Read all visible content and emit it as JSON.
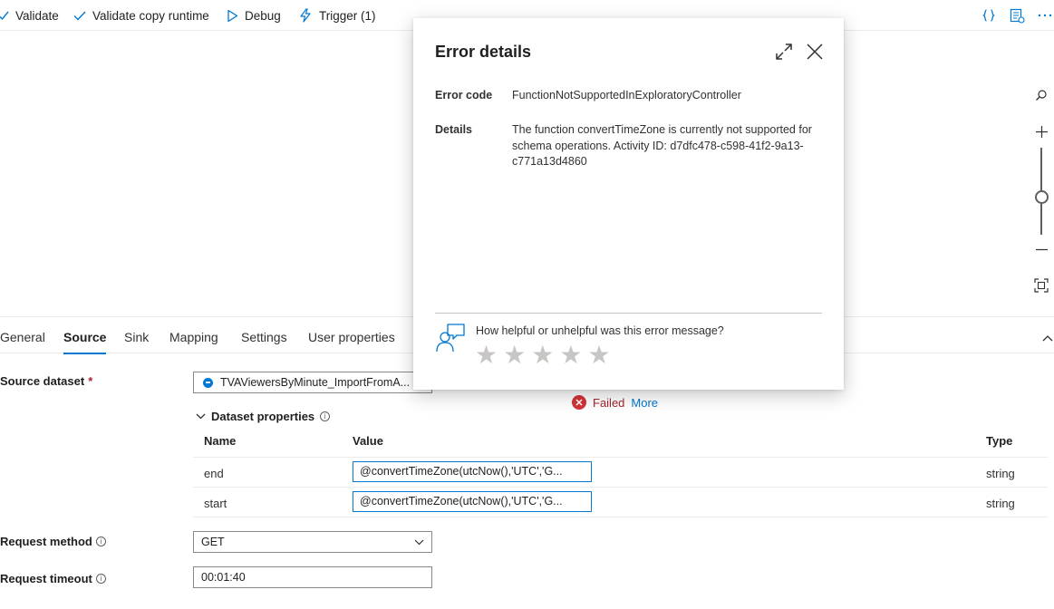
{
  "toolbar": {
    "validate": "Validate",
    "validate_copy_runtime": "Validate copy runtime",
    "debug": "Debug",
    "trigger": "Trigger (1)"
  },
  "tabs": [
    "General",
    "Source",
    "Sink",
    "Mapping",
    "Settings",
    "User properties"
  ],
  "active_tab": "Source",
  "form": {
    "source_dataset_label": "Source dataset",
    "required_mark": "*",
    "source_dataset_value": "TVAViewersByMinute_ImportFromA...",
    "status_failed": "Failed",
    "more_link": "More",
    "dataset_properties_label": "Dataset properties",
    "table": {
      "headers": {
        "name": "Name",
        "value": "Value",
        "type": "Type"
      },
      "rows": [
        {
          "name": "end",
          "value": "@convertTimeZone(utcNow(),'UTC','G...",
          "type": "string"
        },
        {
          "name": "start",
          "value": "@convertTimeZone(utcNow(),'UTC','G...",
          "type": "string"
        }
      ]
    },
    "request_method_label": "Request method",
    "request_method_value": "GET",
    "request_timeout_label": "Request timeout",
    "request_timeout_value": "00:01:40"
  },
  "dialog": {
    "title": "Error details",
    "error_code_label": "Error code",
    "error_code_value": "FunctionNotSupportedInExploratoryController",
    "details_label": "Details",
    "details_value": "The function convertTimeZone is currently not supported for schema operations. Activity ID: d7dfc478-c598-41f2-9a13-c771a13d4860",
    "feedback_question": "How helpful or unhelpful was this error message?",
    "star_count": 5
  },
  "colors": {
    "accent": "#0078d4",
    "error": "#d13438",
    "star_empty": "#c8c6c4"
  },
  "icons": {
    "validate": "checkmark-icon",
    "validate_copy_runtime": "checkmark-icon",
    "debug": "play-icon",
    "trigger": "lightning-icon",
    "code": "braces-icon",
    "properties": "properties-icon",
    "more": "ellipsis-icon",
    "search": "search-icon",
    "zoom_in": "plus-icon",
    "zoom_out": "minus-icon",
    "fit": "fit-to-screen-icon",
    "expand": "expand-icon",
    "close": "close-icon",
    "feedback": "feedback-person-icon",
    "failed": "error-circle-icon"
  }
}
